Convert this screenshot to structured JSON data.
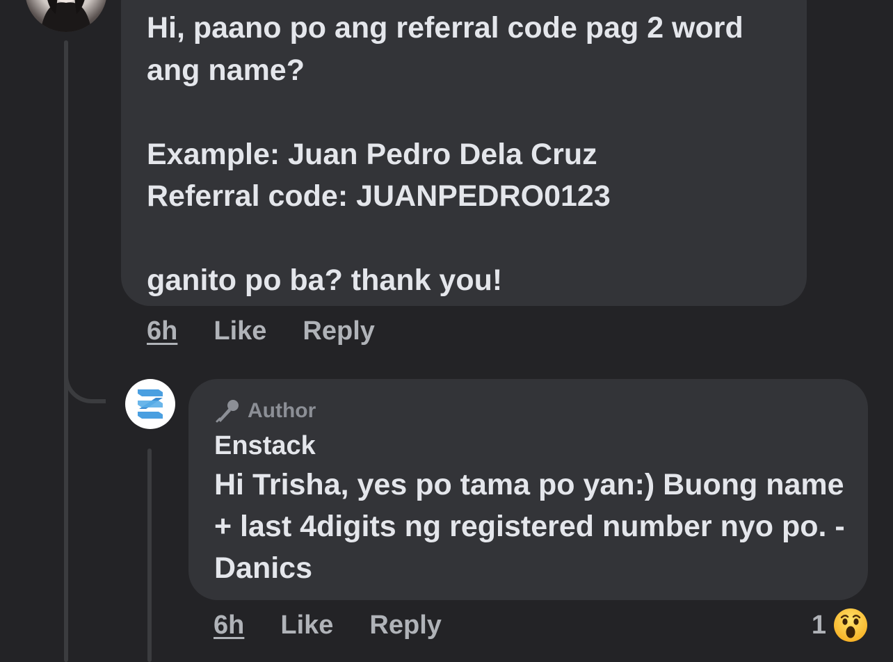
{
  "comment": {
    "text": "Hi, paano po ang referral code pag 2 word\nang name?\n\nExample: Juan Pedro Dela Cruz\nReferral code: JUANPEDRO0123\n\nganito po ba? thank you!",
    "time": "6h",
    "like_label": "Like",
    "reply_label": "Reply"
  },
  "reply": {
    "badge_label": "Author",
    "name": "Enstack",
    "text": "Hi Trisha, yes po tama po yan:) Buong name + last 4digits ng registered number nyo po.  -Danics",
    "time": "6h",
    "like_label": "Like",
    "reply_label": "Reply",
    "reaction_count": "1",
    "reaction_icon": "wow-emoji-icon"
  },
  "colors": {
    "background": "#232326",
    "bubble": "#333438",
    "text": "#e4e6eb",
    "muted": "#b0b3b8",
    "logo_blue": "#4a9fe0"
  }
}
